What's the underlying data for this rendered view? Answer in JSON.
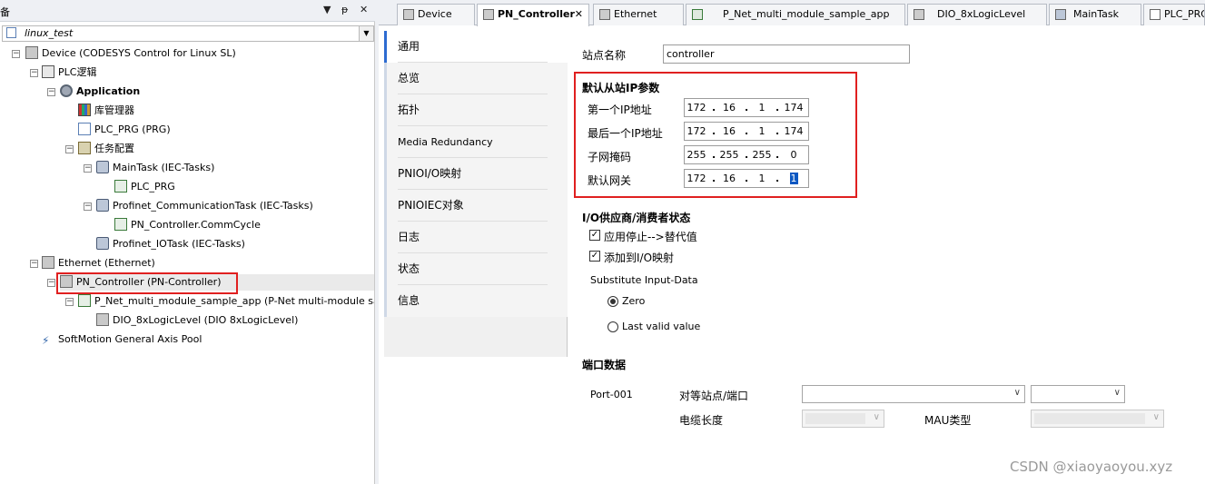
{
  "left_panel": {
    "title": "备",
    "buttons": {
      "dropdown": "▼",
      "pin": "ᵽ",
      "close": "✕"
    },
    "root_combo": "linux_test",
    "tree": {
      "device": "Device (CODESYS Control for Linux SL)",
      "plc_logic": "PLC逻辑",
      "application": "Application",
      "library_manager": "库管理器",
      "plc_prg": "PLC_PRG (PRG)",
      "task_config": "任务配置",
      "main_task": "MainTask (IEC-Tasks)",
      "main_task_call": "PLC_PRG",
      "profinet_comm_task": "Profinet_CommunicationTask (IEC-Tasks)",
      "comm_cycle": "PN_Controller.CommCycle",
      "profinet_io_task": "Profinet_IOTask (IEC-Tasks)",
      "ethernet": "Ethernet (Ethernet)",
      "pn_controller": "PN_Controller (PN-Controller)",
      "pnet_app": "P_Net_multi_module_sample_app (P-Net multi-module sample ap",
      "dio": "DIO_8xLogicLevel (DIO 8xLogicLevel)",
      "softmotion": "SoftMotion General Axis Pool"
    }
  },
  "tabs": [
    {
      "label": "Device"
    },
    {
      "label": "PN_Controller",
      "active": true
    },
    {
      "label": "Ethernet"
    },
    {
      "label": "P_Net_multi_module_sample_app"
    },
    {
      "label": "DIO_8xLogicLevel"
    },
    {
      "label": "MainTask"
    },
    {
      "label": "PLC_PRG"
    }
  ],
  "tab_close": "✕",
  "nav": {
    "items": [
      "通用",
      "总览",
      "拓扑",
      "Media Redundancy",
      "PNIOI/O映射",
      "PNIOIEC对象",
      "日志",
      "状态",
      "信息"
    ]
  },
  "general": {
    "station_name_label": "站点名称",
    "station_name_value": "controller",
    "ip_section_title": "默认从站IP参数",
    "first_ip_label": "第一个IP地址",
    "first_ip": [
      "172",
      "16",
      "1",
      "174"
    ],
    "last_ip_label": "最后一个IP地址",
    "last_ip": [
      "172",
      "16",
      "1",
      "174"
    ],
    "subnet_label": "子网掩码",
    "subnet": [
      "255",
      "255",
      "255",
      "0"
    ],
    "gateway_label": "默认网关",
    "gateway": [
      "172",
      "16",
      "1",
      "1"
    ],
    "io_section_title": "I/O供应商/消费者状态",
    "apply_stop_label": "应用停止-->替代值",
    "apply_stop_checked": true,
    "add_io_label": "添加到I/O映射",
    "add_io_checked": true,
    "substitute_label": "Substitute Input-Data",
    "radio_zero": "Zero",
    "radio_last": "Last valid value",
    "selected_radio": "Zero",
    "port_section_title": "端口数据",
    "port_name": "Port-001",
    "peer_label": "对等站点/端口",
    "cable_label": "电缆长度",
    "mau_label": "MAU类型"
  },
  "watermark": "CSDN @xiaoyaoyou.xyz"
}
